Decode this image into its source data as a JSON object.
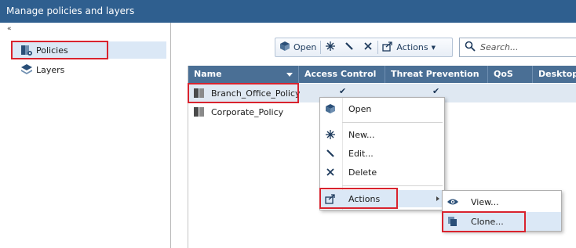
{
  "window": {
    "title": "Manage policies and layers"
  },
  "sidebar": {
    "collapse_glyph": "«",
    "items": [
      {
        "label": "Policies",
        "icon": "policies-icon",
        "selected": true
      },
      {
        "label": "Layers",
        "icon": "layers-icon",
        "selected": false
      }
    ]
  },
  "toolbar": {
    "open_label": "Open",
    "new_icon": "new-icon",
    "edit_icon": "edit-icon",
    "delete_icon": "delete-icon",
    "actions_label": "Actions"
  },
  "search": {
    "placeholder": "Search..."
  },
  "table": {
    "columns": [
      "Name",
      "Access Control",
      "Threat Prevention",
      "QoS",
      "Desktop"
    ],
    "rows": [
      {
        "name": "Branch_Office_Policy",
        "access_control": true,
        "threat_prevention": true,
        "qos": false,
        "desktop": false
      },
      {
        "name": "Corporate_Policy",
        "access_control": false,
        "threat_prevention": false,
        "qos": false,
        "desktop": false
      }
    ],
    "check_glyph": "✔"
  },
  "context_menu": {
    "items": [
      {
        "label": "Open",
        "icon": "open-icon"
      },
      {
        "label": "New...",
        "icon": "new-icon"
      },
      {
        "label": "Edit...",
        "icon": "edit-icon"
      },
      {
        "label": "Delete",
        "icon": "delete-icon"
      },
      {
        "label": "Actions",
        "icon": "actions-icon"
      }
    ]
  },
  "submenu": {
    "items": [
      {
        "label": "View...",
        "icon": "eye-icon"
      },
      {
        "label": "Clone...",
        "icon": "clone-icon"
      }
    ]
  },
  "colors": {
    "title_bar": "#2f5f8f",
    "header": "#4a6f95",
    "selection": "#dbe8f6",
    "highlight_box": "#d9232e"
  }
}
